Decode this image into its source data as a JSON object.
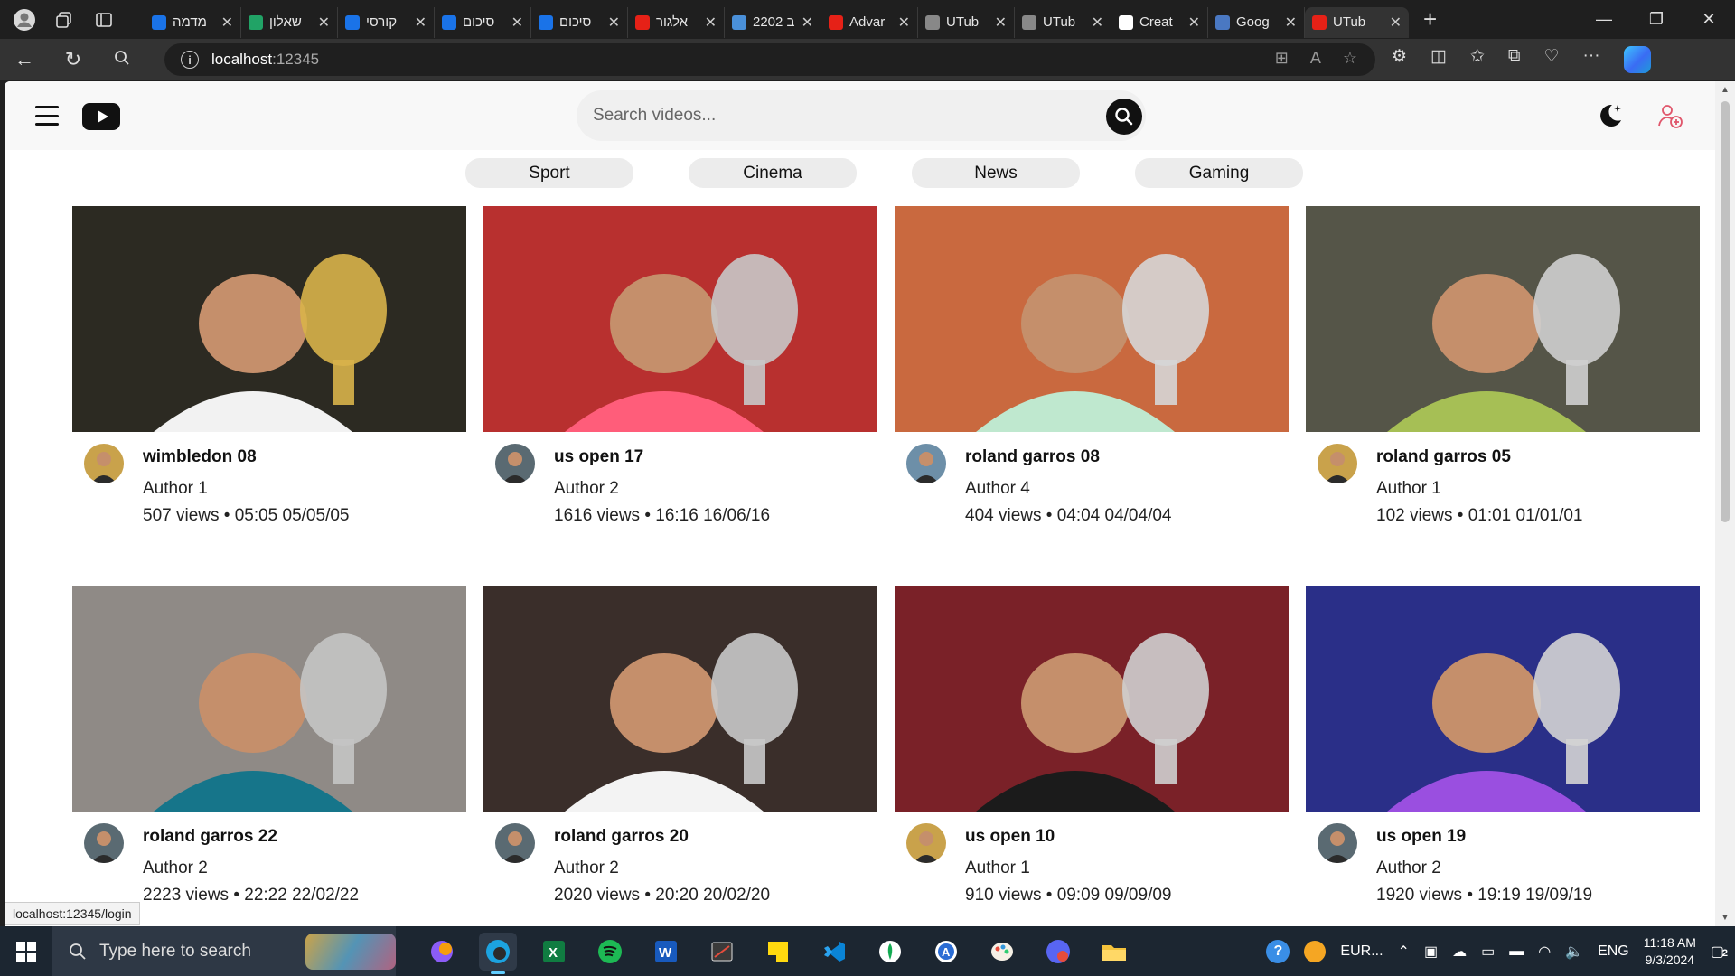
{
  "browser": {
    "tabs": [
      {
        "title": "מדמה",
        "favicon_color": "#1a73e8"
      },
      {
        "title": "שאלון",
        "favicon_color": "#21a366"
      },
      {
        "title": "קורסי",
        "favicon_color": "#1a73e8"
      },
      {
        "title": "סיכום",
        "favicon_color": "#1a73e8"
      },
      {
        "title": "סיכום",
        "favicon_color": "#1a73e8"
      },
      {
        "title": "אלגור",
        "favicon_color": "#e62117"
      },
      {
        "title": "2202 ב",
        "favicon_color": "#4a90d9"
      },
      {
        "title": "Advar",
        "favicon_color": "#e62117"
      },
      {
        "title": "UTub",
        "favicon_color": "#888888"
      },
      {
        "title": "UTub",
        "favicon_color": "#888888"
      },
      {
        "title": "Creat",
        "favicon_color": "#ffffff"
      },
      {
        "title": "Goog",
        "favicon_color": "#4a78c2"
      },
      {
        "title": "UTub",
        "favicon_color": "#e62117"
      }
    ],
    "url_host": "localhost",
    "url_port": ":12345",
    "status_url": "localhost:12345/login"
  },
  "app": {
    "search_placeholder": "Search videos...",
    "categories": [
      "Sport",
      "Cinema",
      "News",
      "Gaming"
    ]
  },
  "videos": [
    {
      "title": "wimbledon 08",
      "author": "Author 1",
      "stats": "507 views • 05:05 05/05/05",
      "bg": "#2c2a22",
      "shirt": "#f2f2f2",
      "trophy": "#d8b34a",
      "avatar": "#c9a24b"
    },
    {
      "title": "us open 17",
      "author": "Author 2",
      "stats": "1616 views • 16:16 16/06/16",
      "bg": "#b8302f",
      "shirt": "#ff5d7a",
      "trophy": "#c8c8c8",
      "avatar": "#5a6a72"
    },
    {
      "title": "roland garros 08",
      "author": "Author 4",
      "stats": "404 views • 04:04 04/04/04",
      "bg": "#c9693f",
      "shirt": "#bfe8cf",
      "trophy": "#d6d6d6",
      "avatar": "#6d8fa8"
    },
    {
      "title": "roland garros 05",
      "author": "Author 1",
      "stats": "102 views • 01:01 01/01/01",
      "bg": "#555548",
      "shirt": "#a6bf55",
      "trophy": "#cfcfcf",
      "avatar": "#c9a24b"
    },
    {
      "title": "roland garros 22",
      "author": "Author 2",
      "stats": "2223 views • 22:22 22/02/22",
      "bg": "#8f8a86",
      "shirt": "#16758a",
      "trophy": "#c4c4c4",
      "avatar": "#5a6a72"
    },
    {
      "title": "roland garros 20",
      "author": "Author 2",
      "stats": "2020 views • 20:20 20/02/20",
      "bg": "#3a2e2a",
      "shirt": "#f3f3f3",
      "trophy": "#c9c9c9",
      "avatar": "#5a6a72"
    },
    {
      "title": "us open 10",
      "author": "Author 1",
      "stats": "910 views • 09:09 09/09/09",
      "bg": "#7a2128",
      "shirt": "#1b1b1b",
      "trophy": "#cfcfcf",
      "avatar": "#c9a24b"
    },
    {
      "title": "us open 19",
      "author": "Author 2",
      "stats": "1920 views • 19:19 19/09/19",
      "bg": "#2a2f88",
      "shirt": "#9a4fe0",
      "trophy": "#d4d4d4",
      "avatar": "#5a6a72"
    }
  ],
  "taskbar": {
    "search_placeholder": "Type here to search",
    "weather": "EUR...",
    "language": "ENG",
    "time": "11:18 AM",
    "date": "9/3/2024",
    "notifications": "2"
  }
}
